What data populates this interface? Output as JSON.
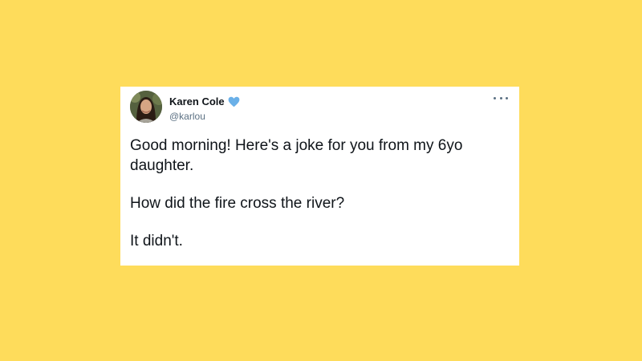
{
  "colors": {
    "background": "#fedc5b",
    "card": "#ffffff",
    "text": "#0f1419",
    "secondary_text": "#5b7083",
    "verified": "#6ab0e8"
  },
  "tweet": {
    "author_name": "Karen Cole",
    "handle": "@karlou",
    "verified_icon": "heart-icon",
    "more_icon": "more-options-icon",
    "paragraphs": [
      "Good morning! Here's a joke for you from my 6yo daughter.",
      "How did the fire cross the river?",
      "It didn't."
    ]
  }
}
